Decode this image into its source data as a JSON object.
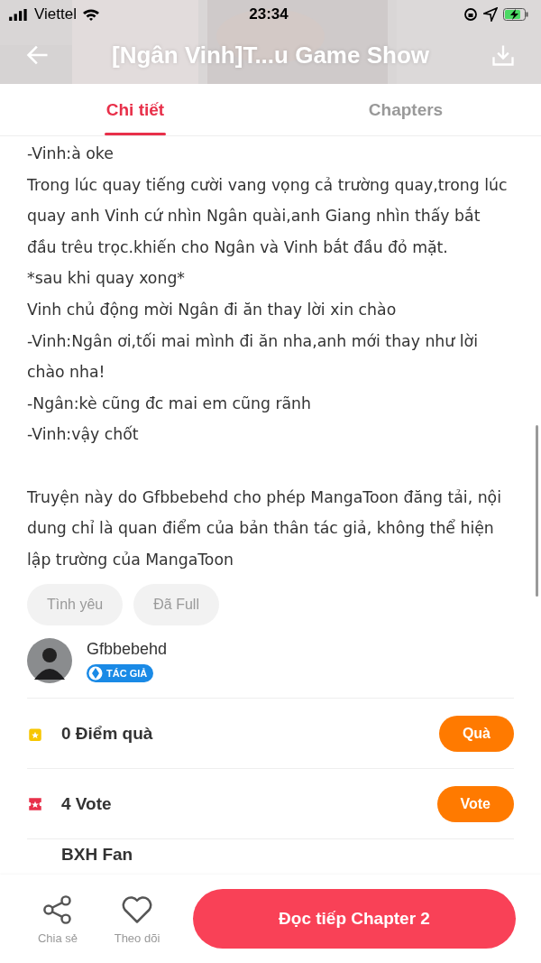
{
  "status_bar": {
    "carrier": "Viettel",
    "time": "23:34"
  },
  "header": {
    "title": "[Ngân Vinh]T...u Game Show"
  },
  "tabs": [
    {
      "label": "Chi tiết",
      "selected": true
    },
    {
      "label": "Chapters",
      "selected": false
    }
  ],
  "story_lines": [
    "-Vinh:à oke",
    "Trong lúc quay tiếng cười vang vọng cả trường quay,trong lúc quay anh Vinh cứ nhìn Ngân quài,anh Giang nhìn thấy bắt đầu trêu trọc.khiến cho Ngân và Vinh bắt đầu đỏ mặt.",
    "*sau khi quay xong*",
    "Vinh chủ động mời Ngân đi ăn thay lời xin chào",
    "-Vinh:Ngân ơi,tối mai mình đi ăn nha,anh mới thay như lời chào nha!",
    "-Ngân:kè cũng đc mai em cũng rãnh",
    "-Vinh:vậy chốt"
  ],
  "notice": "Truyện này do Gfbbebehd cho phép MangaToon đăng tải, nội dung chỉ là quan điểm của bản thân tác giả, không thể hiện lập trường của MangaToon",
  "tags": [
    "Tình yêu",
    "Đã Full"
  ],
  "author": {
    "name": "Gfbbebehd",
    "badge": "TÁC GIẢ"
  },
  "stats": [
    {
      "kind": "gift",
      "label": "0 Điểm quà",
      "button": "Quà"
    },
    {
      "kind": "vote",
      "label": "4 Vote",
      "button": "Vote"
    }
  ],
  "ranking": {
    "label": "BXH Fan"
  },
  "bottom_bar": {
    "actions": [
      {
        "kind": "share",
        "label": "Chia sẻ"
      },
      {
        "kind": "follow",
        "label": "Theo dõi"
      }
    ],
    "read_button": "Đọc tiếp Chapter 2"
  }
}
